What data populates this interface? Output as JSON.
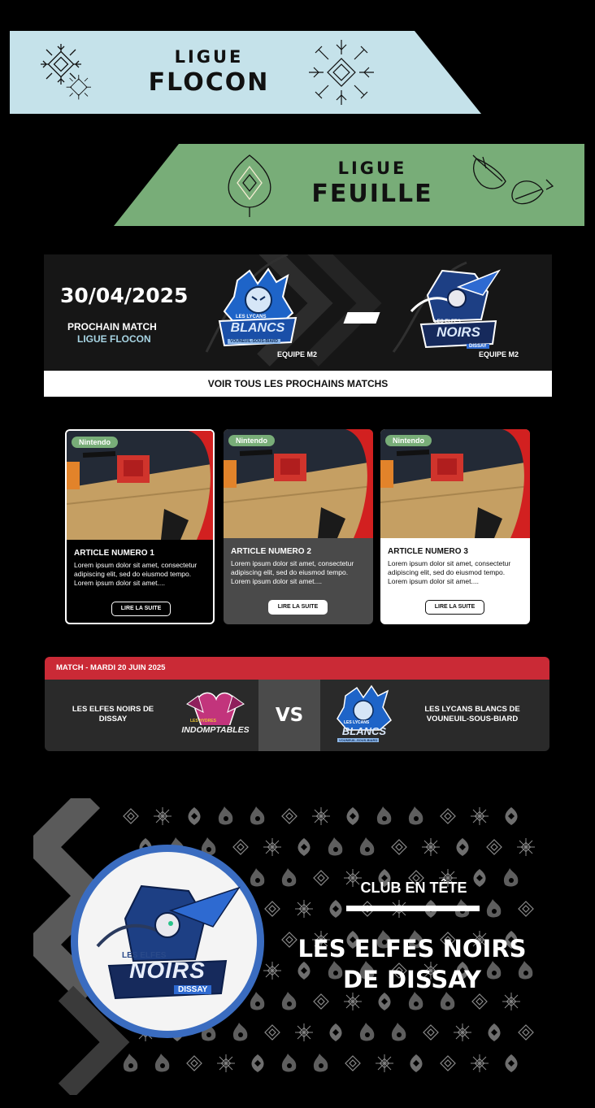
{
  "leagues": [
    {
      "small": "LIGUE",
      "big": "FLOCON",
      "color": "#c5e2ea"
    },
    {
      "small": "LIGUE",
      "big": "FEUILLE",
      "color": "#78ad78"
    }
  ],
  "next_match": {
    "date": "30/04/2025",
    "title": "PROCHAIN MATCH",
    "league": "LIGUE FLOCON",
    "home_tag": "EQUIPE M2",
    "away_tag": "EQUIPE M2",
    "home_logo_text": {
      "top": "LES LYCANS",
      "main": "BLANCS",
      "sub": "VOUNEUIL-SOUS-BIARD"
    },
    "away_logo_text": {
      "top": "LES ELFES",
      "main": "NOIRS",
      "sub": "DISSAY"
    },
    "see_all": "VOIR TOUS LES PROCHAINS MATCHS"
  },
  "articles": [
    {
      "tag": "Nintendo",
      "title": "ARTICLE NUMERO 1",
      "desc": "Lorem ipsum dolor sit amet, consectetur adipiscing elit, sed do eiusmod tempo. Lorem ipsum dolor sit amet....",
      "button": "LIRE LA SUITE"
    },
    {
      "tag": "Nintendo",
      "title": "ARTICLE NUMERO 2",
      "desc": "Lorem ipsum dolor sit amet, consectetur adipiscing elit, sed do eiusmod tempo. Lorem ipsum dolor sit amet....",
      "button": "LIRE LA SUITE"
    },
    {
      "tag": "Nintendo",
      "title": "ARTICLE NUMERO 3",
      "desc": "Lorem ipsum dolor sit amet, consectetur adipiscing elit, sed do eiusmod tempo. Lorem ipsum dolor sit amet....",
      "button": "LIRE LA SUITE"
    }
  ],
  "match": {
    "header": "MATCH - MARDI 20 JUIN 2025",
    "home": "LES ELFES NOIRS DE DISSAY",
    "away": "LES LYCANS BLANCS DE VOUNEUIL-SOUS-BIARD",
    "vs": "VS",
    "home_logo_text": {
      "main": "INDOMPTABLES",
      "top": "LES HYDRES"
    },
    "away_logo_text": {
      "main": "BLANCS",
      "top": "LES LYCANS",
      "sub": "VOUNEUIL-SOUS-BIARD"
    }
  },
  "club": {
    "label": "CLUB EN TÊTE",
    "name_line1": "LES ELFES NOIRS",
    "name_line2": "DE DISSAY",
    "logo_text": {
      "top": "LES ELFES",
      "main": "NOIRS",
      "sub": "DISSAY"
    },
    "ring_color": "#3a6cc0"
  },
  "colors": {
    "flocon": "#c5e2ea",
    "feuille": "#78ad78",
    "match_red": "#ca2a36"
  }
}
